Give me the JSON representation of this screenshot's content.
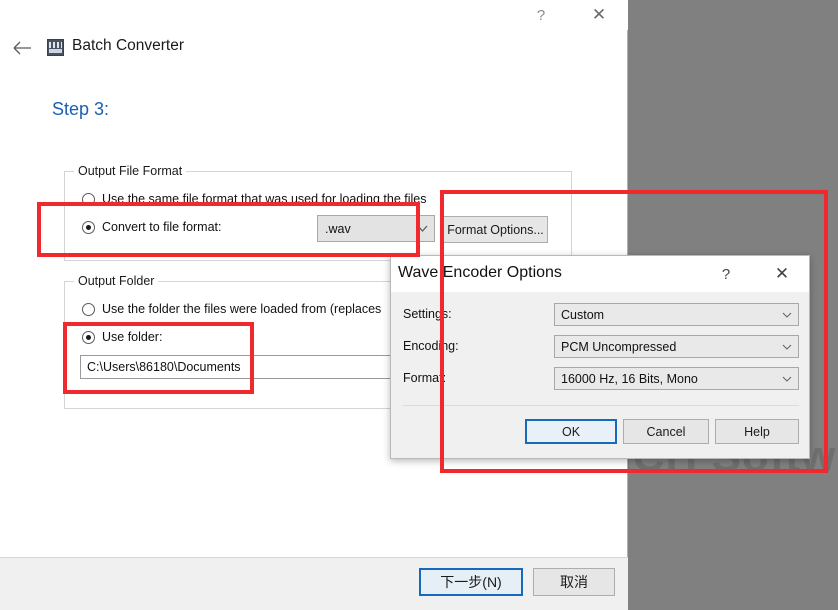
{
  "desktop": {
    "watermark": "NCH Softw"
  },
  "main_window": {
    "title": "Batch Converter",
    "app_icon": "batch-converter-icon",
    "back_icon": "back-arrow-icon",
    "help_icon": "?",
    "close_icon": "✕",
    "step_title": "Step 3:",
    "groups": {
      "output_file_format": {
        "legend": "Output File Format",
        "options": [
          {
            "label": "Use the same file format that was used for loading the files",
            "checked": false
          },
          {
            "label": "Convert to file format:",
            "checked": true
          }
        ],
        "format_combo": {
          "value": ".wav",
          "arrow": "⌄"
        },
        "format_options_button": "Format Options..."
      },
      "output_folder": {
        "legend": "Output Folder",
        "options": [
          {
            "label": "Use the folder the files were loaded from (replaces",
            "checked": false
          },
          {
            "label": "Use folder:",
            "checked": true
          }
        ],
        "path_value": "C:\\Users\\86180\\Documents"
      }
    },
    "footer": {
      "next_button": "下一步(N)",
      "cancel_button": "取消"
    }
  },
  "wave_dialog": {
    "title": "Wave Encoder Options",
    "help_icon": "?",
    "close_icon": "✕",
    "rows": [
      {
        "label": "Settings:",
        "value": "Custom",
        "arrow": "⌄"
      },
      {
        "label": "Encoding:",
        "value": "PCM Uncompressed",
        "arrow": "⌄"
      },
      {
        "label": "Format:",
        "value": "16000 Hz, 16 Bits, Mono",
        "arrow": "⌄"
      }
    ],
    "buttons": {
      "ok": "OK",
      "cancel": "Cancel",
      "help": "Help"
    }
  },
  "annotations": {
    "accent_color": "#f0292f",
    "boxes": [
      {
        "name": "convert-to-file-format-highlight"
      },
      {
        "name": "use-folder-highlight"
      },
      {
        "name": "wave-encoder-dialog-highlight"
      }
    ]
  }
}
